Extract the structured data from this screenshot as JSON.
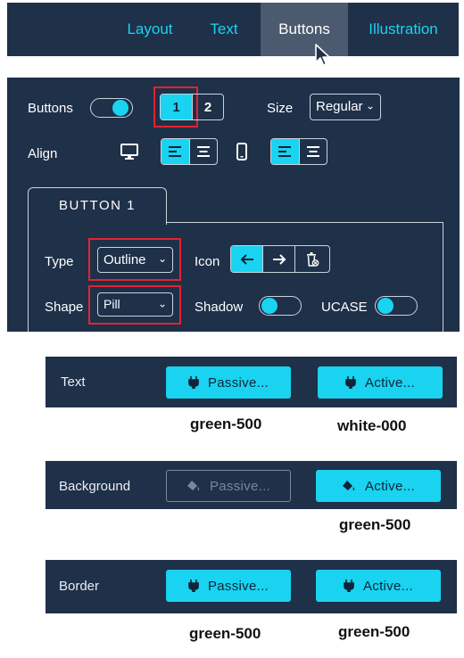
{
  "tabs": [
    {
      "label": "Layout",
      "active": false
    },
    {
      "label": "Text",
      "active": false
    },
    {
      "label": "Buttons",
      "active": true
    },
    {
      "label": "Illustration",
      "active": false
    }
  ],
  "panel": {
    "buttons_label": "Buttons",
    "buttons_toggle_on": true,
    "button_numbers": [
      "1",
      "2"
    ],
    "size_label": "Size",
    "size_value": "Regular",
    "align_label": "Align",
    "subtab_label": "BUTTON 1",
    "type_label": "Type",
    "type_value": "Outline",
    "icon_label": "Icon",
    "shape_label": "Shape",
    "shape_value": "Pill",
    "shadow_label": "Shadow",
    "ucase_label": "UCASE"
  },
  "rows": [
    {
      "label": "Text",
      "passive_label": "Passive...",
      "active_label": "Active...",
      "passive_caption": "green-500",
      "active_caption": "white-000"
    },
    {
      "label": "Background",
      "passive_label": "Passive...",
      "active_label": "Active...",
      "passive_caption": "",
      "active_caption": "green-500"
    },
    {
      "label": "Border",
      "passive_label": "Passive...",
      "active_label": "Active...",
      "passive_caption": "green-500",
      "active_caption": "green-500"
    }
  ],
  "colors": {
    "panel_bg": "#1f3049",
    "accent": "#19d3f0",
    "highlight": "#e52230",
    "active_tab_bg": "#4b5a6e"
  },
  "icons": [
    "arrow-cursor-icon",
    "desktop-icon",
    "mobile-icon",
    "align-left-icon",
    "align-center-icon",
    "arrow-left-icon",
    "arrow-right-icon",
    "trash-icon",
    "plug-icon",
    "paint-bucket-icon"
  ]
}
